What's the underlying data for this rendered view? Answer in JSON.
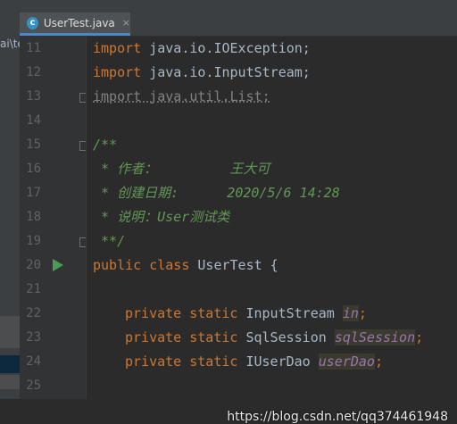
{
  "project_path_fragment": "ai\\te",
  "tab": {
    "label": "UserTest.java",
    "icon": "java-class-icon",
    "close": "×"
  },
  "lines": [
    {
      "no": "11",
      "fold": false,
      "run": false
    },
    {
      "no": "12",
      "fold": false,
      "run": false
    },
    {
      "no": "13",
      "fold": true,
      "run": false
    },
    {
      "no": "14",
      "fold": false,
      "run": false
    },
    {
      "no": "15",
      "fold": true,
      "run": false
    },
    {
      "no": "16",
      "fold": false,
      "run": false
    },
    {
      "no": "17",
      "fold": false,
      "run": false
    },
    {
      "no": "18",
      "fold": false,
      "run": false
    },
    {
      "no": "19",
      "fold": true,
      "run": false
    },
    {
      "no": "20",
      "fold": false,
      "run": true
    },
    {
      "no": "21",
      "fold": false,
      "run": false
    },
    {
      "no": "22",
      "fold": false,
      "run": false
    },
    {
      "no": "23",
      "fold": false,
      "run": false
    },
    {
      "no": "24",
      "fold": false,
      "run": false
    },
    {
      "no": "25",
      "fold": false,
      "run": false
    }
  ],
  "code": {
    "l11_kw": "import",
    "l11_rest": " java.io.IOException;",
    "l12_kw": "import",
    "l12_rest": " java.io.InputStream;",
    "l13": "import java.util.List;",
    "l15": "/**",
    "l16": " * 作者：         王大可",
    "l17": " * 创建日期:      2020/5/6 14:28",
    "l18": " * 说明：User测试类",
    "l19": " **/",
    "l20_kw": "public class",
    "l20_rest": " UserTest {",
    "l22_kw": "private static",
    "l22_type": " InputStream ",
    "l22_field": "in",
    "l22_end": ";",
    "l23_kw": "private static",
    "l23_type": " SqlSession ",
    "l23_field": "sqlSession",
    "l23_end": ";",
    "l24_kw": "private static",
    "l24_type": " IUserDao ",
    "l24_field": "userDao",
    "l24_end": ";"
  },
  "watermark": "https://blog.csdn.net/qq374461948",
  "colors": {
    "keyword": "#cc7832",
    "comment": "#629755",
    "field": "#9876aa",
    "run": "#499c54",
    "tab_accent": "#4a88c7"
  }
}
